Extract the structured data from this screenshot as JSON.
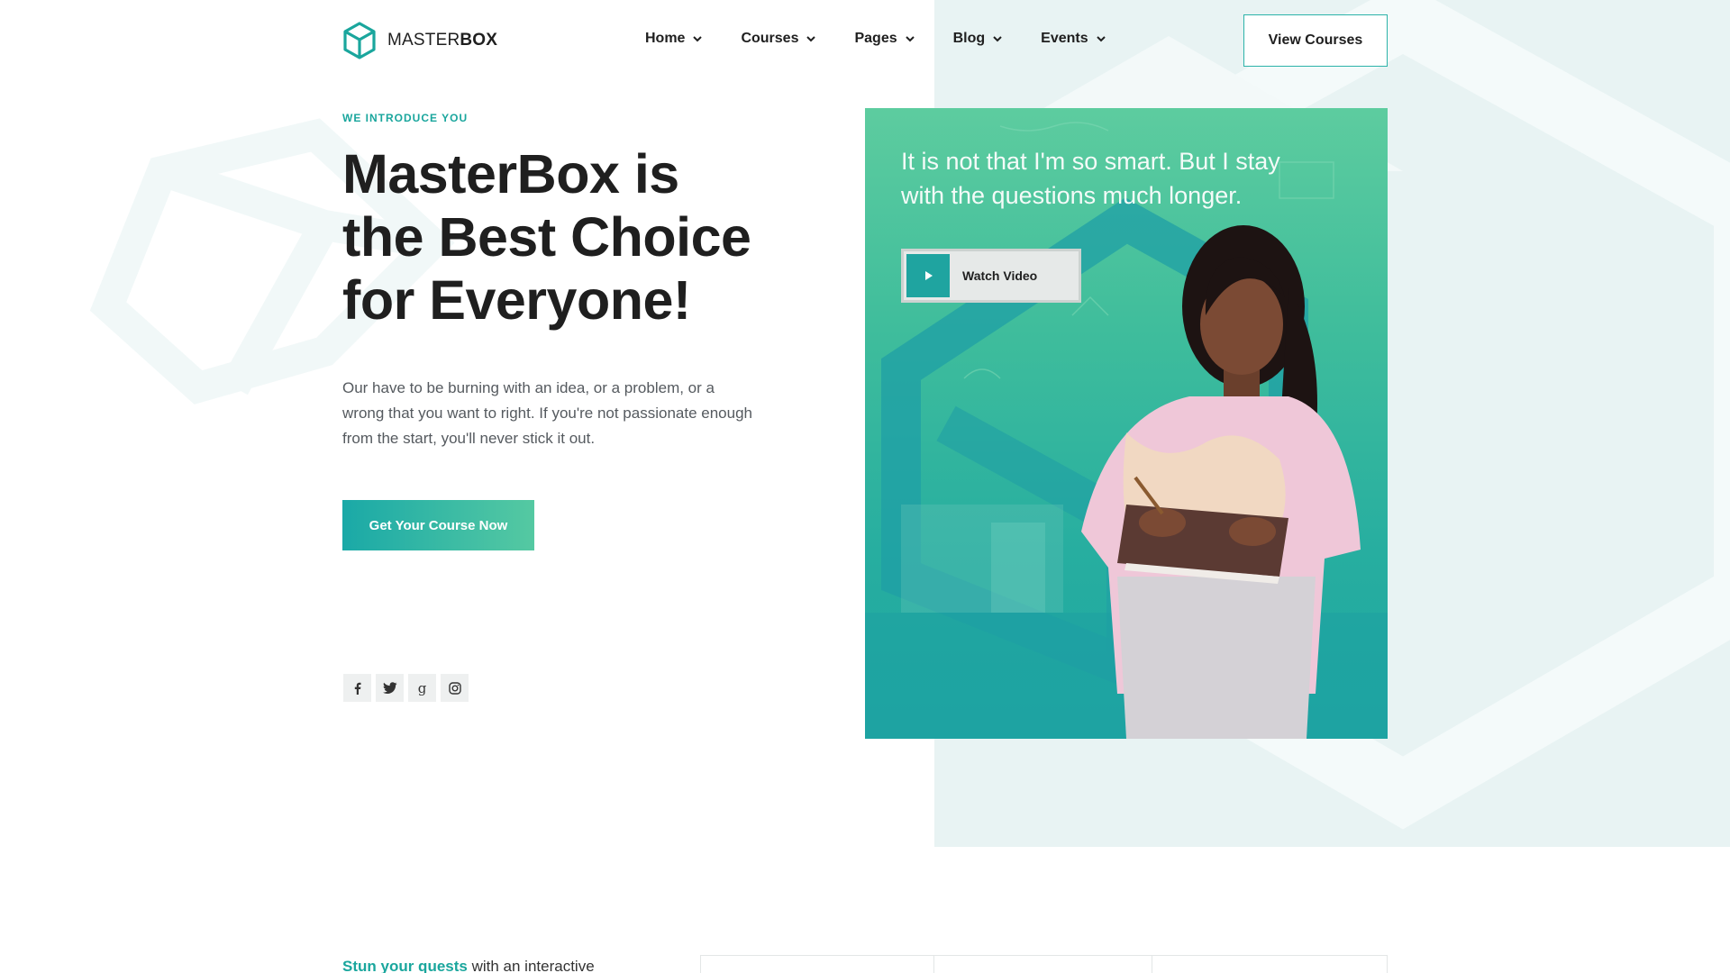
{
  "brand": {
    "name_light": "MASTER",
    "name_bold": "BOX",
    "accent": "#1aa69d"
  },
  "nav": [
    {
      "label": "Home"
    },
    {
      "label": "Courses"
    },
    {
      "label": "Pages"
    },
    {
      "label": "Blog"
    },
    {
      "label": "Events"
    }
  ],
  "header": {
    "cta_label": "View Courses"
  },
  "hero": {
    "eyebrow": "WE INTRODUCE YOU",
    "title": "MasterBox is the Best Choice for Everyone!",
    "text": "Our have to be burning with an idea, or a problem, or a wrong that you want to right. If you're not passionate enough from the start, you'll never stick it out.",
    "cta_label": "Get Your Course Now"
  },
  "socials": [
    {
      "icon": "facebook-icon"
    },
    {
      "icon": "twitter-icon"
    },
    {
      "icon": "google-icon"
    },
    {
      "icon": "instagram-icon"
    }
  ],
  "card": {
    "quote": "It is not that I'm so smart. But I stay with the questions much longer.",
    "watch_label": "Watch Video"
  },
  "below": {
    "accent": "Stun your quests",
    "rest": " with an interactive"
  }
}
